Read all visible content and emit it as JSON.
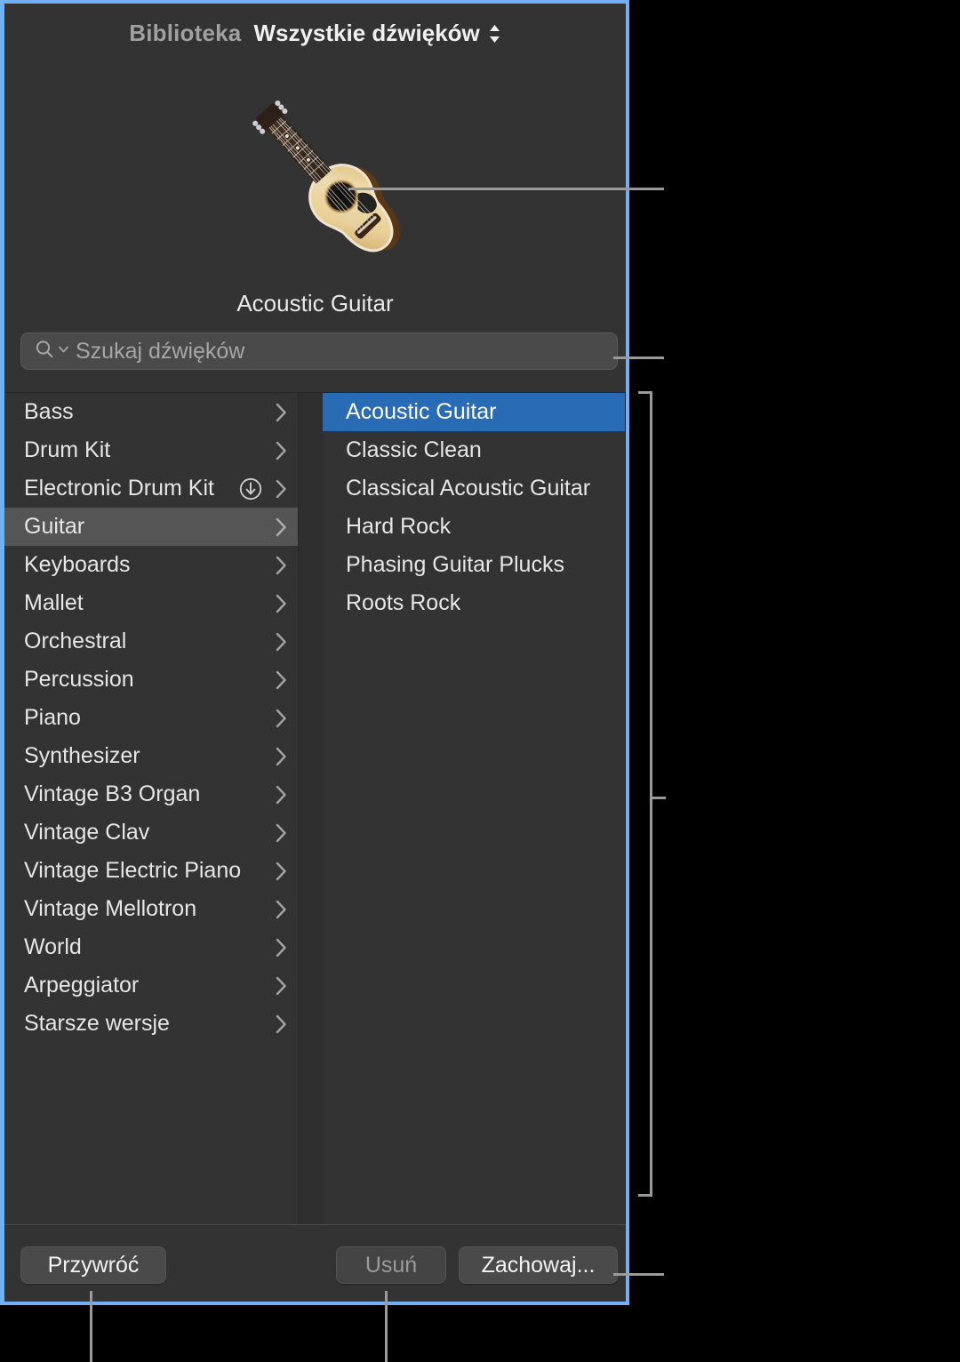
{
  "window": {
    "header": {
      "title": "Biblioteka",
      "menu_value": "Wszystkie dźwięków",
      "menu_icon": "up-down-chevron-icon"
    },
    "preview": {
      "image_name": "acoustic-guitar-image",
      "patch_name": "Acoustic Guitar"
    },
    "search": {
      "icon": "search-icon",
      "dropdown_icon": "chevron-down-icon",
      "placeholder": "Szukaj dźwięków",
      "value": ""
    },
    "browser": {
      "categories": [
        {
          "label": "Bass",
          "selected": false,
          "download": false
        },
        {
          "label": "Drum Kit",
          "selected": false,
          "download": false
        },
        {
          "label": "Electronic Drum Kit",
          "selected": false,
          "download": true
        },
        {
          "label": "Guitar",
          "selected": true,
          "download": false
        },
        {
          "label": "Keyboards",
          "selected": false,
          "download": false
        },
        {
          "label": "Mallet",
          "selected": false,
          "download": false
        },
        {
          "label": "Orchestral",
          "selected": false,
          "download": false
        },
        {
          "label": "Percussion",
          "selected": false,
          "download": false
        },
        {
          "label": "Piano",
          "selected": false,
          "download": false
        },
        {
          "label": "Synthesizer",
          "selected": false,
          "download": false
        },
        {
          "label": "Vintage B3 Organ",
          "selected": false,
          "download": false
        },
        {
          "label": "Vintage Clav",
          "selected": false,
          "download": false
        },
        {
          "label": "Vintage Electric Piano",
          "selected": false,
          "download": false
        },
        {
          "label": "Vintage Mellotron",
          "selected": false,
          "download": false
        },
        {
          "label": "World",
          "selected": false,
          "download": false
        },
        {
          "label": "Arpeggiator",
          "selected": false,
          "download": false
        },
        {
          "label": "Starsze wersje",
          "selected": false,
          "download": false
        }
      ],
      "patches": [
        {
          "label": "Acoustic Guitar",
          "selected": true
        },
        {
          "label": "Classic Clean",
          "selected": false
        },
        {
          "label": "Classical Acoustic Guitar",
          "selected": false
        },
        {
          "label": "Hard Rock",
          "selected": false
        },
        {
          "label": "Phasing Guitar Plucks",
          "selected": false
        },
        {
          "label": "Roots Rock",
          "selected": false
        }
      ]
    },
    "footer": {
      "restore_label": "Przywróć",
      "delete_label": "Usuń",
      "delete_disabled": true,
      "save_label": "Zachowaj..."
    }
  },
  "colors": {
    "selection_blue": "#2a6bb5",
    "window_border_blue": "#6eb1f7",
    "panel_bg": "#333333",
    "row_selected_gray": "#555555",
    "callout_gray": "#9a9a9a",
    "backdrop": "#000000"
  }
}
